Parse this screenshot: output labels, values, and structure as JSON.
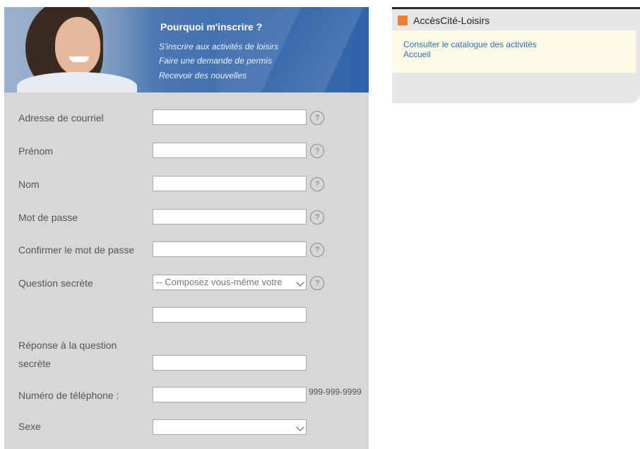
{
  "banner": {
    "title": "Pourquoi m'inscrire ?",
    "items": [
      "S'inscrire aux activités de loisirs",
      "Faire une demande de permis",
      "Recevoir des nouvelles"
    ]
  },
  "form": {
    "fields": [
      {
        "label": "Adresse de courriel",
        "value": ""
      },
      {
        "label": "Prénom",
        "value": ""
      },
      {
        "label": "Nom",
        "value": ""
      },
      {
        "label": "Mot de passe",
        "value": ""
      },
      {
        "label": "Confirmer le mot de passe",
        "value": ""
      }
    ],
    "secret_question": {
      "label": "Question secrète",
      "selected": "-- Composez vous-même votre",
      "custom_value": ""
    },
    "secret_answer": {
      "label_line1": "Réponse à la question",
      "label_line2": "secrète",
      "value": ""
    },
    "phone": {
      "label": "Numéro de téléphone :",
      "value": "",
      "hint": "999-999-9999"
    },
    "sex": {
      "label": "Sexe",
      "selected": ""
    },
    "help_glyph": "?"
  },
  "sidebar_box": {
    "title": "AccèsCité-Loisirs",
    "links": [
      "Consulter le catalogue des activités",
      "Accueil"
    ],
    "accent_color": "#ee7e33"
  }
}
